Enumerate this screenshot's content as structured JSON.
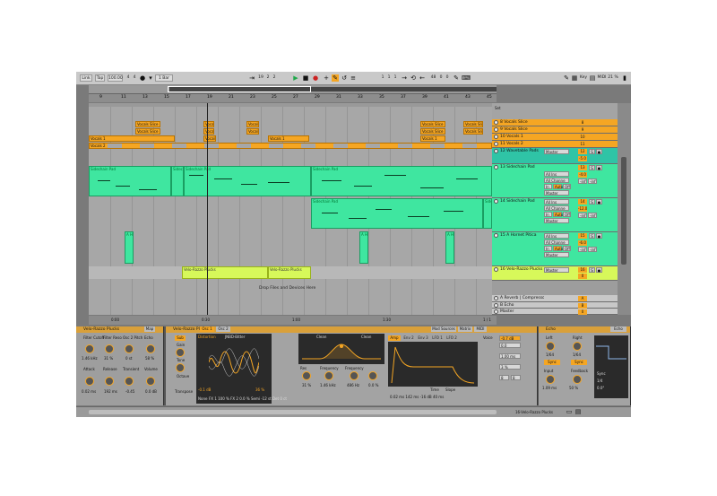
{
  "control_bar": {
    "link": "Link",
    "tap": "Tap",
    "tempo": "100.00",
    "sig_num": "4",
    "sig_den": "4",
    "quantize": "1 Bar",
    "position": [
      "19",
      "2",
      "2"
    ],
    "loop_start": [
      "1",
      "1",
      "1"
    ],
    "loop_len": [
      "48",
      "0",
      "0"
    ],
    "key": "Key",
    "midi": "MIDI",
    "cpu": "21 %"
  },
  "ruler": {
    "bars": [
      "9",
      "11",
      "13",
      "15",
      "17",
      "19",
      "21",
      "23",
      "25",
      "27",
      "29",
      "31",
      "33",
      "35",
      "37",
      "39",
      "41",
      "43",
      "45"
    ]
  },
  "time_ruler": [
    "0:00",
    "0:30",
    "1:00",
    "1:30"
  ],
  "set_label": "Set",
  "clips": {
    "vocals_slice": "Vocals Slice",
    "vocals_1": "Vocals 1",
    "vocals_2": "Vocals 2",
    "sidechain": "Sidechain Pad",
    "sidechain_short": "Sidec",
    "hornet": "A Hor",
    "velo": "Velo-Razzo Plucks",
    "drop_hint": "Drop Files and Devices Here"
  },
  "tracks": [
    {
      "name": "8 Vocals Slice",
      "num": "8"
    },
    {
      "name": "9 Vocals Slice",
      "num": "9"
    },
    {
      "name": "10 Vocals 1",
      "num": "10"
    },
    {
      "name": "11 Vocals 2",
      "num": "11"
    },
    {
      "name": "12 Wavetable Pads",
      "num": "12",
      "vol": "-5.0"
    },
    {
      "name": "13 Sidechain Pad",
      "num": "13",
      "vol": "-4.0"
    },
    {
      "name": "14 Sidechain Pad",
      "num": "14",
      "vol": "-12.0"
    },
    {
      "name": "15 A Hornet Pitica",
      "num": "15",
      "vol": "-6.0"
    },
    {
      "name": "16 Velo-Razzo Plucks",
      "num": "16",
      "vol": "0"
    },
    {
      "name": "A Reverb | Compressor",
      "num": "A"
    },
    {
      "name": "B Echo",
      "num": "B"
    },
    {
      "name": "Master",
      "num": "0"
    }
  ],
  "routing": {
    "master": "Master",
    "all_ins": "All Ins",
    "all_channels": "All Channe",
    "in": "In",
    "auto": "Auto",
    "off": "Off",
    "inf": "-inf"
  },
  "page_counter": "1 / 1",
  "devices": {
    "rack_title": "Velo-Razzo Plucks",
    "map": "Map",
    "macros": [
      "Filter Cutoff",
      "Filter Reso",
      "Osc 2 Pitch",
      "Echo",
      "Attack",
      "Release",
      "Transient",
      "Volume"
    ],
    "macro_values": [
      "1.46 kHz",
      "31 %",
      "0 st",
      "58 %",
      "0.02 ms",
      "192 ms",
      "-0.45",
      "0.0 dB"
    ],
    "wavetable": {
      "sub": "Sub",
      "gain": "Gain",
      "gain_val": "-23L",
      "tone": "Tone",
      "octave": "Octave",
      "transpose": "Transpose",
      "distortion": "Distortion",
      "filter_type": "JNBD-Bitter",
      "osc_tabs": [
        "Osc 1",
        "Osc 2"
      ],
      "osc_footer": "FX 1 100 %   FX 2 0.0 %   Semi -12 st   Det 0 ct",
      "none": "None",
      "val_l": "-0.1 dB",
      "val_r": "36 %",
      "filter_left": "Clean",
      "filter_right": "Clean",
      "filter_tabs": [
        "Freq",
        "Res",
        "Drive"
      ],
      "res": "Res",
      "res_val": "31 %",
      "freq": "Frequency",
      "freq_val": "1.46 kHz",
      "freq2_val": "486 Hz",
      "res2_val": "0.0 %",
      "env_tabs": [
        "Amp",
        "Env 2",
        "Env 3",
        "LFO 1",
        "LFO 2"
      ],
      "time": "Time",
      "slope": "Slope",
      "env_vals": "0.02 ms   142 ms   -16 dB   40 ms",
      "mod_tabs": [
        "Mod Sources",
        "Matrix",
        "MIDI"
      ],
      "voice": "Voice",
      "voice_vals": [
        "-0.7 dB",
        "0.0",
        "1.00 ms",
        "3 %",
        "8",
        "8"
      ]
    },
    "echo": {
      "title": "Echo",
      "tabs": [
        "Echo"
      ],
      "left": "Left",
      "right": "Right",
      "div_l": "1/64",
      "div_r": "1/64",
      "sync": "Sync",
      "feedback": "Feedback",
      "input": "Input",
      "mode": "Mode",
      "vals": [
        "1.09 ms",
        "0.00 ms",
        "50 %"
      ],
      "rate": "1/4",
      "phase": "0.0°"
    }
  },
  "bottom": {
    "track_label": "16-Velo-Razzo Plucks"
  },
  "colors": {
    "clip_orange": "#f5a623",
    "clip_green": "#3fe6a0",
    "clip_lime": "#d7f85a",
    "background": "#7a7a7a"
  }
}
